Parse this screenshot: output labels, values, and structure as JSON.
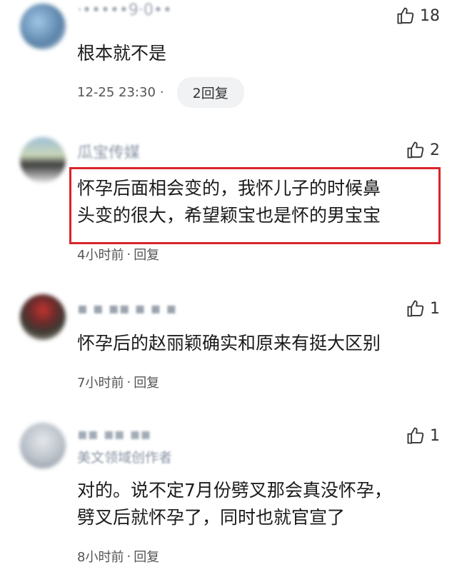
{
  "comments": [
    {
      "user": "·•••••9·0••",
      "likes": "18",
      "text_lines": [
        "根本就不是"
      ],
      "time": "12-25 23:30",
      "separator": "·",
      "reply": "2回复"
    },
    {
      "user": "瓜宝传媒",
      "likes": "2",
      "text_lines": [
        "怀孕后面相会变的，我怀儿子的时候鼻",
        "头变的很大，希望颖宝也是怀的男宝宝"
      ],
      "time": "4小时前",
      "separator": "·",
      "reply": "回复"
    },
    {
      "user": "▪ ▪ ▪▪ ▪ ▪ ▪",
      "likes": "1",
      "text_lines": [
        "怀孕后的赵丽颖确实和原来有挺大区别"
      ],
      "time": "7小时前",
      "separator": "·",
      "reply": "回复"
    },
    {
      "user": "▪▪ ▪▪ ▪▪",
      "user_sub": "美文领域创作者",
      "likes": "1",
      "text_lines": [
        "对的。说不定7月份劈叉那会真没怀孕，",
        "劈叉后就怀孕了，同时也就官宣了"
      ],
      "time": "8小时前",
      "separator": "·",
      "reply": "回复"
    }
  ],
  "colors": {
    "highlight_border": "#d9252a",
    "meta_text": "#555555",
    "name_text": "#8a95a5"
  },
  "icons": {
    "like": "thumbs-up-icon"
  }
}
